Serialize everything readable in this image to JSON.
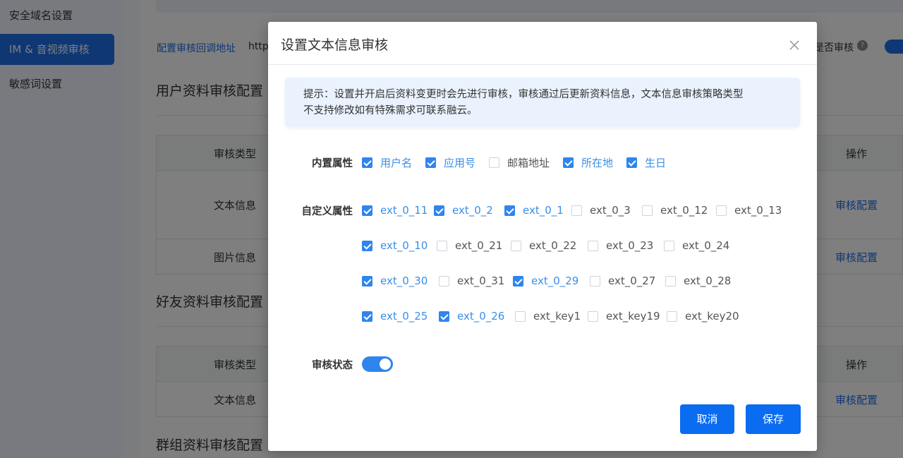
{
  "sidebar": {
    "items": [
      {
        "label": "安全域名设置",
        "active": false
      },
      {
        "label": "IM & 音视频审核",
        "active": true
      },
      {
        "label": "敏感词设置",
        "active": false
      }
    ]
  },
  "page": {
    "callback_link": "配置审核回调地址",
    "callback_url": "http",
    "audit_toggle_label": "是否审核",
    "sections": [
      {
        "title": "用户资料审核配置",
        "columns": {
          "type": "审核类型",
          "operation": "操作"
        },
        "rows": [
          {
            "type": "文本信息",
            "action": "审核配置"
          },
          {
            "type": "图片信息",
            "action": "审核配置"
          }
        ]
      },
      {
        "title": "好友资料审核配置",
        "columns": {
          "type": "审核类型",
          "operation": "操作"
        },
        "rows": [
          {
            "type": "文本信息",
            "action": "审核配置"
          }
        ]
      },
      {
        "title": "群组资料审核配置"
      }
    ]
  },
  "dialog": {
    "title": "设置文本信息审核",
    "tip_line1": "提示：设置并开启后资料变更时会先进行审核，审核通过后更新资料信息，文本信息审核策略类型",
    "tip_line2": "不支持修改如有特殊需求可联系融云。",
    "builtin_label": "内置属性",
    "builtin": [
      {
        "label": "用户名",
        "checked": true
      },
      {
        "label": "应用号",
        "checked": true
      },
      {
        "label": "邮箱地址",
        "checked": false
      },
      {
        "label": "所在地",
        "checked": true
      },
      {
        "label": "生日",
        "checked": true
      }
    ],
    "custom_label": "自定义属性",
    "custom_rows": [
      [
        {
          "label": "ext_0_11",
          "checked": true
        },
        {
          "label": "ext_0_2",
          "checked": true
        },
        {
          "label": "ext_0_1",
          "checked": true
        },
        {
          "label": "ext_0_3",
          "checked": false
        },
        {
          "label": "ext_0_12",
          "checked": false
        },
        {
          "label": "ext_0_13",
          "checked": false
        }
      ],
      [
        {
          "label": "ext_0_10",
          "checked": true
        },
        {
          "label": "ext_0_21",
          "checked": false
        },
        {
          "label": "ext_0_22",
          "checked": false
        },
        {
          "label": "ext_0_23",
          "checked": false
        },
        {
          "label": "ext_0_24",
          "checked": false
        }
      ],
      [
        {
          "label": "ext_0_30",
          "checked": true
        },
        {
          "label": "ext_0_31",
          "checked": false
        },
        {
          "label": "ext_0_29",
          "checked": true
        },
        {
          "label": "ext_0_27",
          "checked": false
        },
        {
          "label": "ext_0_28",
          "checked": false
        }
      ],
      [
        {
          "label": "ext_0_25",
          "checked": true
        },
        {
          "label": "ext_0_26",
          "checked": true
        },
        {
          "label": "ext_key1",
          "checked": false
        },
        {
          "label": "ext_key19",
          "checked": false
        },
        {
          "label": "ext_key20",
          "checked": false
        }
      ]
    ],
    "status_label": "审核状态",
    "status_on": true,
    "cancel_label": "取消",
    "save_label": "保存"
  },
  "colors": {
    "accent": "#1f6fe8",
    "checkbox": "#2f85ee",
    "overlay": "rgba(0,0,0,0.5)"
  }
}
